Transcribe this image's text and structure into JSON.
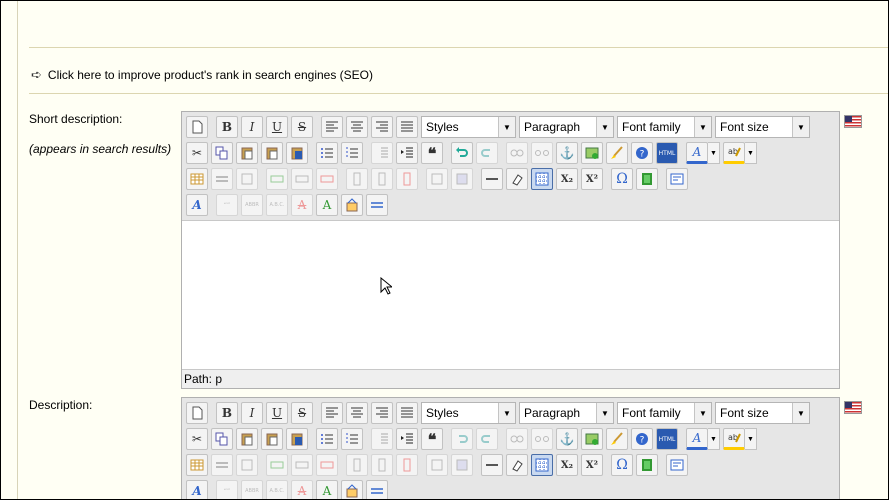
{
  "seo_link": "Click here to improve product's rank in search engines (SEO)",
  "short_description": {
    "label": "Short description:",
    "sublabel": "(appears in search results)",
    "path": "Path: p"
  },
  "description": {
    "label": "Description:"
  },
  "toolbar": {
    "styles": "Styles",
    "paragraph": "Paragraph",
    "font_family": "Font family",
    "font_size": "Font size",
    "bold": "B",
    "italic": "I",
    "underline": "U",
    "strike": "S",
    "blockquote": "❝",
    "html": "HTML",
    "omega": "Ω",
    "quote_btn": "“”",
    "abbr": "ABBR",
    "acronym": "A.B.C.",
    "text_color": "A",
    "subscript": "X₂",
    "superscript": "X²"
  },
  "colors": {
    "background": "#fffff4",
    "toolbar": "#e6e6e6",
    "active": "#c9d9f0"
  }
}
